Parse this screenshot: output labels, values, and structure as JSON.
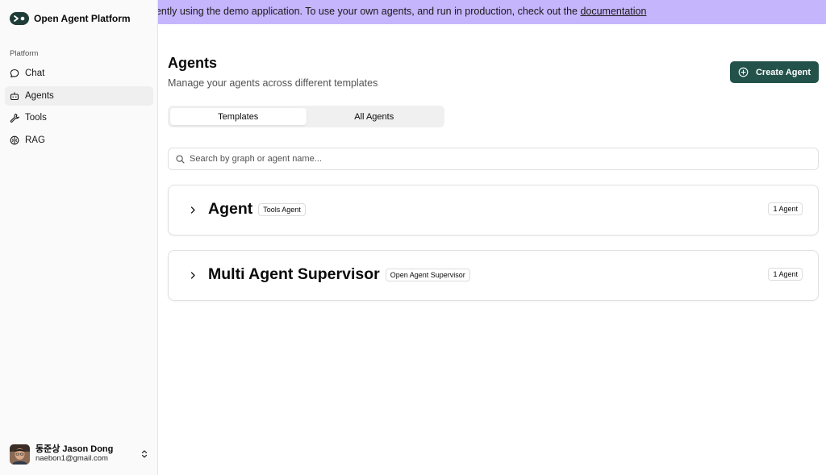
{
  "sidebar": {
    "brand_name": "Open Agent Platform",
    "group_label": "Platform",
    "items": [
      {
        "label": "Chat",
        "icon": "chat-bubble-icon",
        "active": false
      },
      {
        "label": "Agents",
        "icon": "bot-icon",
        "active": true
      },
      {
        "label": "Tools",
        "icon": "wrench-icon",
        "active": false
      },
      {
        "label": "RAG",
        "icon": "brain-icon",
        "active": false
      }
    ],
    "user": {
      "name": "동준상 Jason Dong",
      "email": "naebon1@gmail.com"
    }
  },
  "banner": {
    "text": "e currently using the demo application. To use your own agents, and run in production, check out the ",
    "link_label": "documentation"
  },
  "header": {
    "title": "Agents",
    "subtitle": "Manage your agents across different templates",
    "create_button_label": "Create Agent"
  },
  "tabs": [
    {
      "label": "Templates",
      "active": true
    },
    {
      "label": "All Agents",
      "active": false
    }
  ],
  "search": {
    "placeholder": "Search by graph or agent name...",
    "value": ""
  },
  "templates": [
    {
      "title": "Agent",
      "tag": "Tools Agent",
      "count": "1 Agent"
    },
    {
      "title": "Multi Agent Supervisor",
      "tag": "Open Agent Supervisor",
      "count": "1 Agent"
    }
  ],
  "colors": {
    "banner_bg": "#c4b5fd",
    "primary_button": "#23524a",
    "sidebar_bg": "#fafafa"
  }
}
